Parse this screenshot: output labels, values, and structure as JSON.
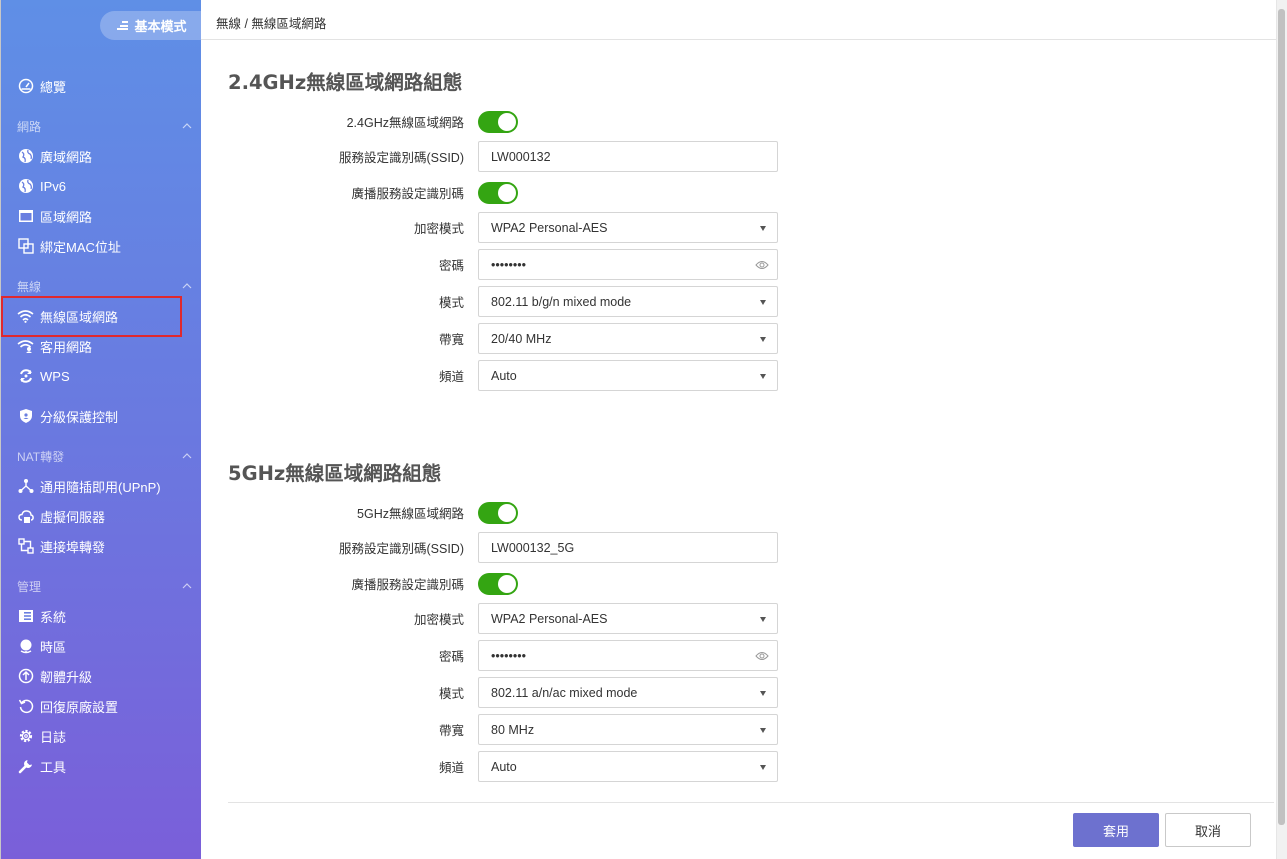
{
  "sidebar": {
    "mode_label": "基本模式",
    "overview": "總覽",
    "sections": {
      "network": "網路",
      "wireless": "無線",
      "nat": "NAT轉發",
      "management": "管理"
    },
    "items": {
      "wan": "廣域網路",
      "ipv6": "IPv6",
      "lan": "區域網路",
      "mac_binding": "綁定MAC位址",
      "wlan": "無線區域網路",
      "guest": "客用網路",
      "wps": "WPS",
      "parental": "分級保護控制",
      "upnp": "通用隨插即用(UPnP)",
      "virtual_server": "虛擬伺服器",
      "port_forward": "連接埠轉發",
      "system": "系統",
      "timezone": "時區",
      "firmware": "韌體升級",
      "factory_reset": "回復原廠設置",
      "log": "日誌",
      "tools": "工具"
    }
  },
  "breadcrumb": "無線 / 無線區域網路",
  "band24": {
    "title": "2.4GHz無線區域網路組態",
    "labels": {
      "enable": "2.4GHz無線區域網路",
      "ssid": "服務設定識別碼(SSID)",
      "broadcast": "廣播服務設定識別碼",
      "encryption": "加密模式",
      "password": "密碼",
      "mode": "模式",
      "bandwidth": "帶寬",
      "channel": "頻道"
    },
    "values": {
      "enable": true,
      "ssid": "LW000132",
      "broadcast": true,
      "encryption": "WPA2 Personal-AES",
      "password": "••••••••",
      "mode": "802.11 b/g/n mixed mode",
      "bandwidth": "20/40 MHz",
      "channel": "Auto"
    }
  },
  "band5": {
    "title": "5GHz無線區域網路組態",
    "labels": {
      "enable": "5GHz無線區域網路",
      "ssid": "服務設定識別碼(SSID)",
      "broadcast": "廣播服務設定識別碼",
      "encryption": "加密模式",
      "password": "密碼",
      "mode": "模式",
      "bandwidth": "帶寬",
      "channel": "頻道"
    },
    "values": {
      "enable": true,
      "ssid": "LW000132_5G",
      "broadcast": true,
      "encryption": "WPA2 Personal-AES",
      "password": "••••••••",
      "mode": "802.11 a/n/ac mixed mode",
      "bandwidth": "80 MHz",
      "channel": "Auto"
    }
  },
  "buttons": {
    "apply": "套用",
    "cancel": "取消"
  },
  "colors": {
    "toggle_on": "#34a512",
    "apply_button": "#6d71cf",
    "highlight": "#e0282d"
  }
}
